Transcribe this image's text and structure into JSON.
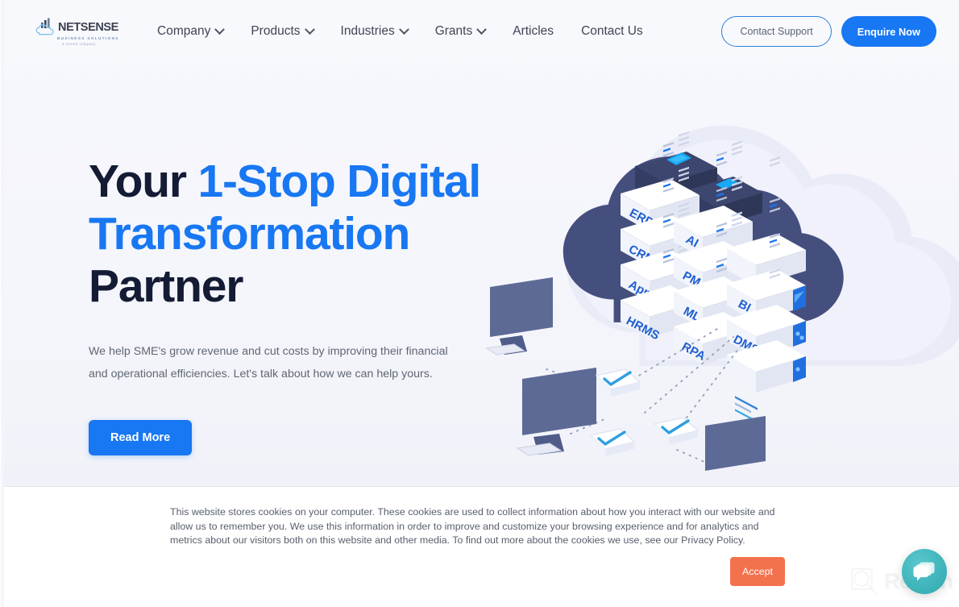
{
  "header": {
    "logo": {
      "name": "NETSENSE",
      "subtitle": "BUSINESS SOLUTIONS",
      "tagline": "a censof company"
    },
    "nav": [
      {
        "label": "Company",
        "has_dropdown": true
      },
      {
        "label": "Products",
        "has_dropdown": true
      },
      {
        "label": "Industries",
        "has_dropdown": true
      },
      {
        "label": "Grants",
        "has_dropdown": true
      },
      {
        "label": "Articles",
        "has_dropdown": false
      },
      {
        "label": "Contact Us",
        "has_dropdown": false
      }
    ],
    "contact_support_label": "Contact Support",
    "enquire_label": "Enquire Now"
  },
  "hero": {
    "headline_part1": "Your ",
    "headline_accent1": "1-Stop Digital",
    "headline_accent2": "Transformation",
    "headline_part2": " Partner",
    "subcopy": "We help SME's grow revenue and cut costs by improving their financial and operational efficiencies. Let's talk about how we can help yours.",
    "cta_label": "Read More",
    "illustration": {
      "name": "cloud-servers-isometric",
      "rack_labels": [
        "ERP",
        "CRM",
        "App",
        "HRMS",
        "AI",
        "PM",
        "ML",
        "RPA",
        "BI",
        "DMS"
      ]
    }
  },
  "cookie_banner": {
    "text": "This website stores cookies on your computer. These cookies are used to collect information about how you interact with our website and allow us to remember you. We use this information in order to improve and customize your browsing experience and for analytics and metrics about our visitors both on this website and other media. To find out more about the cookies we use, see our Privacy Policy.",
    "accept_label": "Accept"
  },
  "watermark": {
    "text": "Revain"
  },
  "chat_widget": {
    "icon": "chat-bubbles-icon"
  },
  "colors": {
    "brand_blue": "#1877f2",
    "headline_dark": "#141b34",
    "accept_orange": "#f4714e",
    "chat_teal": "#3fb3ba",
    "page_bg": "#f6f7fc"
  }
}
